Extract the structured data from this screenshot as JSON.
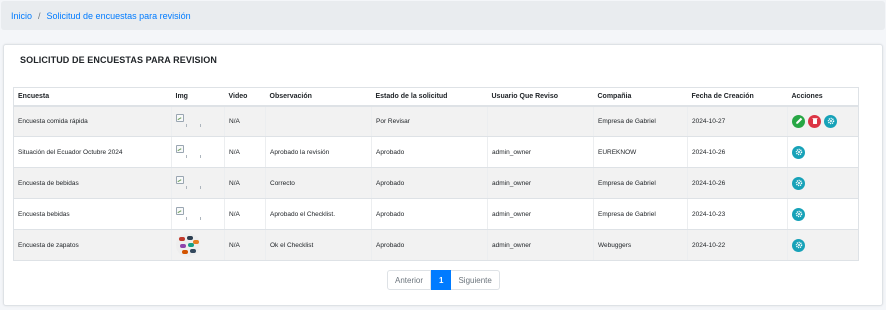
{
  "breadcrumb": {
    "home": "Inicio",
    "separator": "/",
    "current": "Solicitud de encuestas para revisión"
  },
  "card": {
    "title": "SOLICITUD DE ENCUESTAS PARA REVISION"
  },
  "table": {
    "headers": [
      "Encuesta",
      "Img",
      "Video",
      "Observación",
      "Estado de la solicitud",
      "Usuario Que Reviso",
      "Compañia",
      "Fecha de Creación",
      "Acciones"
    ],
    "rows": [
      {
        "encuesta": "Encuesta comida rápida",
        "img": "broken-image",
        "video": "N/A",
        "observacion": "",
        "estado": "Por Revisar",
        "usuario": "",
        "compania": "Empresa de Gabriel",
        "fecha": "2024-10-27",
        "actions": [
          "edit",
          "delete",
          "settings"
        ]
      },
      {
        "encuesta": "Situación del Ecuador Octubre 2024",
        "img": "broken-image",
        "video": "N/A",
        "observacion": "Aprobado la revisión",
        "estado": "Aprobado",
        "usuario": "admin_owner",
        "compania": "EUREKNOW",
        "fecha": "2024-10-26",
        "actions": [
          "settings"
        ]
      },
      {
        "encuesta": "Encuesta de bebidas",
        "img": "broken-image",
        "video": "N/A",
        "observacion": "Correcto",
        "estado": "Aprobado",
        "usuario": "admin_owner",
        "compania": "Empresa de Gabriel",
        "fecha": "2024-10-26",
        "actions": [
          "settings"
        ]
      },
      {
        "encuesta": "Encuesta bebidas",
        "img": "broken-image",
        "video": "N/A",
        "observacion": "Aprobado el Checklist.",
        "estado": "Aprobado",
        "usuario": "admin_owner",
        "compania": "Empresa de Gabriel",
        "fecha": "2024-10-23",
        "actions": [
          "settings"
        ]
      },
      {
        "encuesta": "Encuesta de zapatos",
        "img": "shoes-thumbnail",
        "video": "N/A",
        "observacion": "Ok el Checklist",
        "estado": "Aprobado",
        "usuario": "admin_owner",
        "compania": "Webuggers",
        "fecha": "2024-10-22",
        "actions": [
          "settings"
        ]
      }
    ]
  },
  "pagination": {
    "prev": "Anterior",
    "current": "1",
    "next": "Siguiente"
  },
  "colors": {
    "link": "#007bff",
    "edit": "#28a745",
    "delete": "#dc3545",
    "settings": "#17a2b8",
    "active_page": "#007bff"
  }
}
